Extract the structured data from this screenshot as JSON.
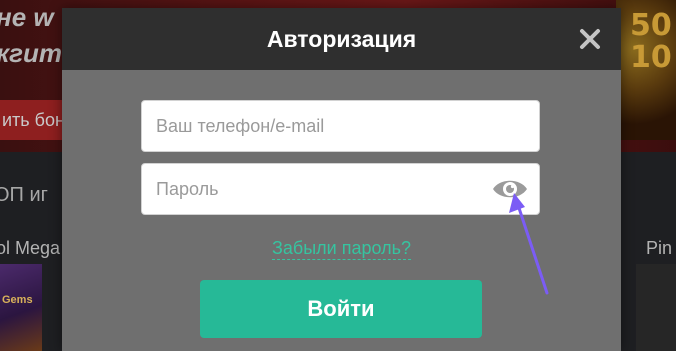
{
  "background": {
    "banner_line_1": "не w",
    "banner_line_2": "кгите",
    "cta_label": "ить бон",
    "section_heading": "ОП иг",
    "game_left_title": "ol Mega",
    "game_right_title": "Pin",
    "thumb_text": "Gems",
    "deco_text": "50\n10"
  },
  "modal": {
    "title": "Авторизация",
    "close_icon": "close-icon",
    "login_placeholder": "Ваш телефон/e-mail",
    "password_placeholder": "Пароль",
    "show_password_icon": "eye-icon",
    "forgot_link": "Забыли пароль?",
    "submit_label": "Войти"
  },
  "colors": {
    "modal_header": "#2f2f2f",
    "modal_body": "#6f6f6f",
    "accent": "#26b997",
    "link": "#36c4a0",
    "annotation_arrow": "#7b5cf5"
  }
}
